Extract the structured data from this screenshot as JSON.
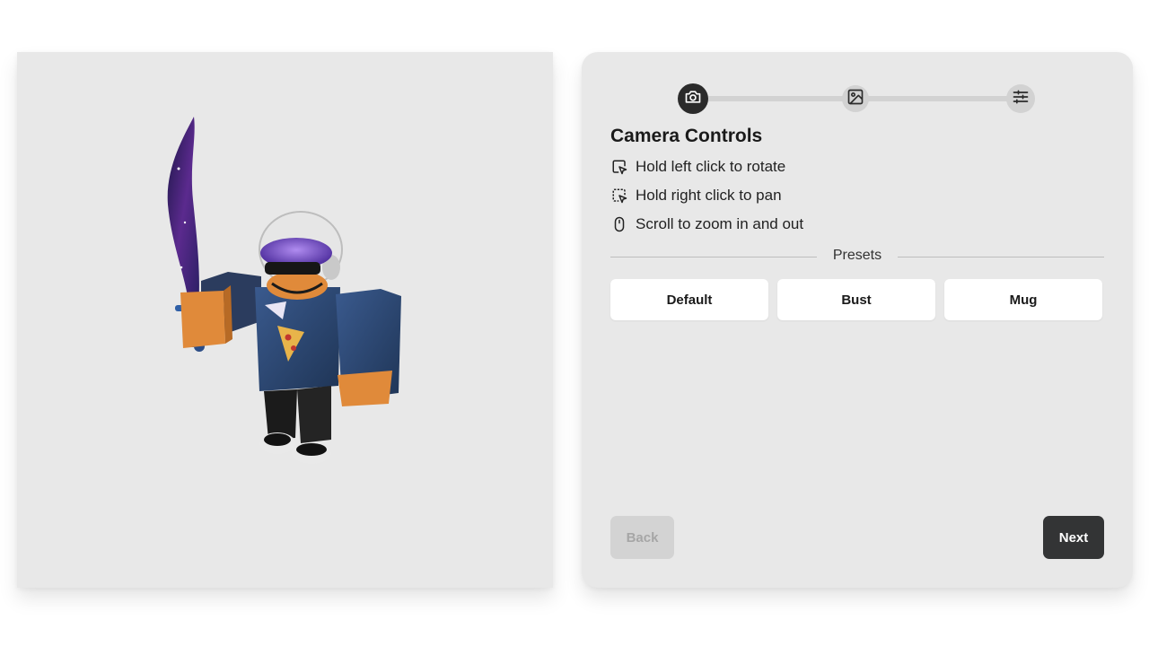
{
  "viewport": {
    "background": "#e8e8e8",
    "model": "avatar-with-galaxy-sword"
  },
  "stepper": {
    "steps": [
      {
        "icon": "camera-icon",
        "state": "active"
      },
      {
        "icon": "image-icon",
        "state": "inactive"
      },
      {
        "icon": "sliders-icon",
        "state": "inactive"
      }
    ]
  },
  "camera_controls": {
    "title": "Camera Controls",
    "instructions": [
      {
        "icon": "left-click-icon",
        "text": "Hold left click to rotate"
      },
      {
        "icon": "right-click-icon",
        "text": "Hold right click to pan"
      },
      {
        "icon": "mouse-scroll-icon",
        "text": "Scroll to zoom in and out"
      }
    ],
    "presets_label": "Presets",
    "presets": [
      "Default",
      "Bust",
      "Mug"
    ]
  },
  "navigation": {
    "back_label": "Back",
    "next_label": "Next",
    "back_enabled": false
  },
  "colors": {
    "panel_bg": "#e8e8e8",
    "active_step": "#2b2b2b",
    "inactive_step": "#d2d2d2",
    "next_button": "#333435",
    "back_disabled": "#d3d3d3"
  }
}
